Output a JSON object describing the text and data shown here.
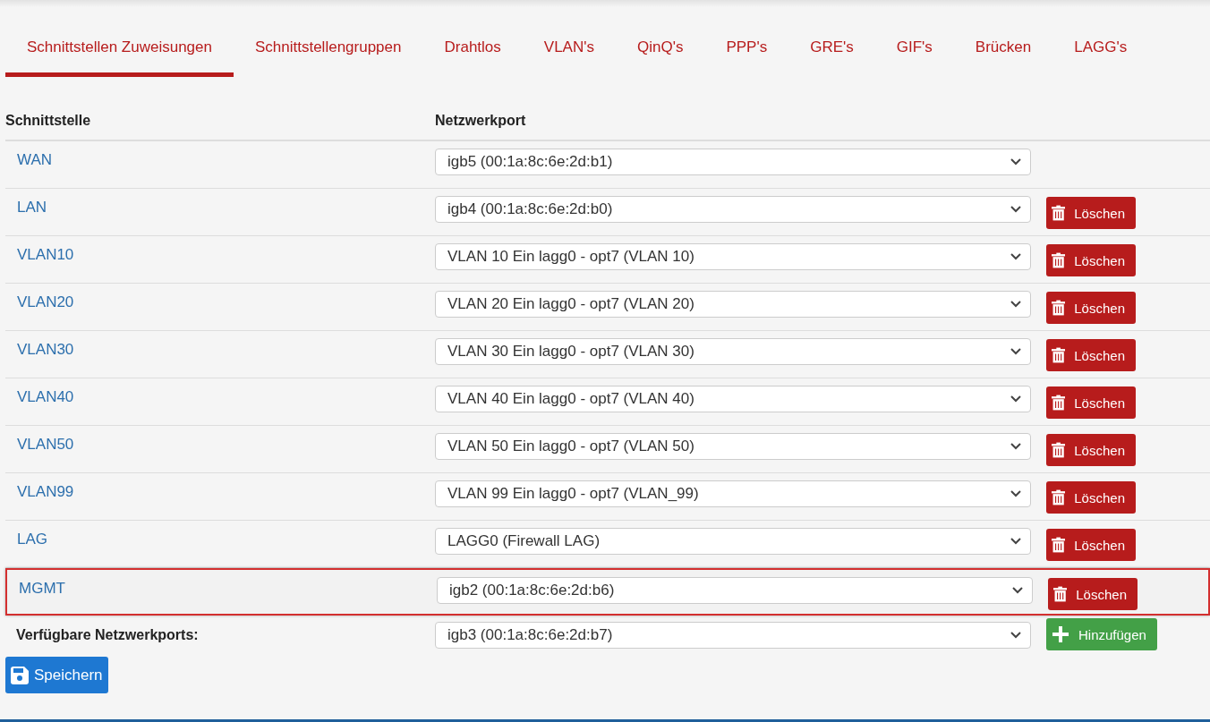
{
  "tabs": [
    {
      "label": "Schnittstellen Zuweisungen",
      "selected": true
    },
    {
      "label": "Schnittstellengruppen",
      "selected": false
    },
    {
      "label": "Drahtlos",
      "selected": false
    },
    {
      "label": "VLAN's",
      "selected": false
    },
    {
      "label": "QinQ's",
      "selected": false
    },
    {
      "label": "PPP's",
      "selected": false
    },
    {
      "label": "GRE's",
      "selected": false
    },
    {
      "label": "GIF's",
      "selected": false
    },
    {
      "label": "Brücken",
      "selected": false
    },
    {
      "label": "LAGG's",
      "selected": false
    }
  ],
  "table": {
    "columns": [
      "Schnittstelle",
      "Netzwerkport"
    ],
    "rows": [
      {
        "interface": "WAN",
        "port": "igb5 (00:1a:8c:6e:2d:b1)",
        "highlighted": false
      },
      {
        "interface": "LAN",
        "port": "igb4 (00:1a:8c:6e:2d:b0)",
        "action": "Löschen",
        "highlighted": false
      },
      {
        "interface": "VLAN10",
        "port": "VLAN 10 Ein lagg0 - opt7 (VLAN 10)",
        "action": "Löschen",
        "highlighted": false
      },
      {
        "interface": "VLAN20",
        "port": "VLAN 20 Ein lagg0 - opt7 (VLAN 20)",
        "action": "Löschen",
        "highlighted": false
      },
      {
        "interface": "VLAN30",
        "port": "VLAN 30 Ein lagg0 - opt7 (VLAN 30)",
        "action": "Löschen",
        "highlighted": false
      },
      {
        "interface": "VLAN40",
        "port": "VLAN 40 Ein lagg0 - opt7 (VLAN 40)",
        "action": "Löschen",
        "highlighted": false
      },
      {
        "interface": "VLAN50",
        "port": "VLAN 50 Ein lagg0 - opt7 (VLAN 50)",
        "action": "Löschen",
        "highlighted": false
      },
      {
        "interface": "VLAN99",
        "port": "VLAN 99 Ein lagg0 - opt7 (VLAN_99)",
        "action": "Löschen",
        "highlighted": false
      },
      {
        "interface": "LAG",
        "port": "LAGG0 (Firewall LAG)",
        "action": "Löschen",
        "highlighted": false
      },
      {
        "interface": "MGMT",
        "port": "igb2 (00:1a:8c:6e:2d:b6)",
        "action": "Löschen",
        "highlighted": true
      }
    ],
    "available": {
      "label": "Verfügbare Netzwerkports:",
      "port": "igb3 (00:1a:8c:6e:2d:b7)",
      "action": "Hinzufügen"
    }
  },
  "save_button": "Speichern"
}
